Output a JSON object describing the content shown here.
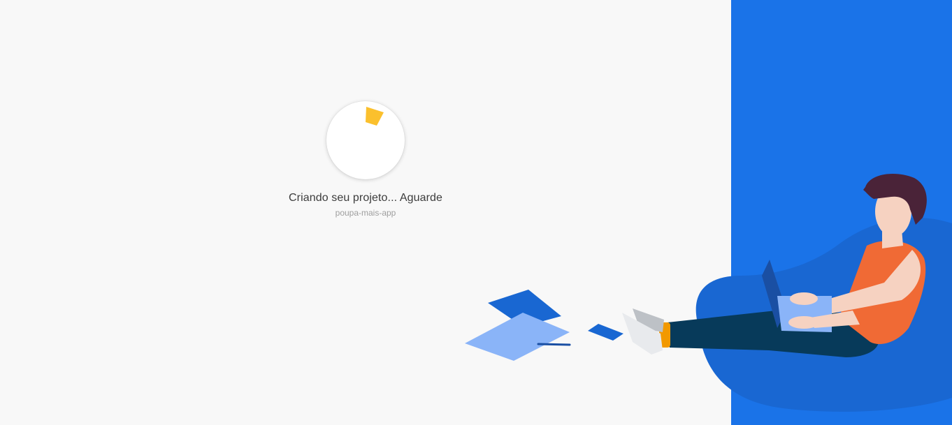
{
  "loading": {
    "status_text": "Criando seu projeto... Aguarde",
    "project_name": "poupa-mais-app",
    "spinner_color": "#fbbc04"
  },
  "colors": {
    "background": "#f8f8f8",
    "panel_blue": "#1a73e8",
    "beanbag_blue": "#1967d2"
  },
  "illustration": {
    "icon": "person-with-laptop-on-beanbag-illustration"
  }
}
